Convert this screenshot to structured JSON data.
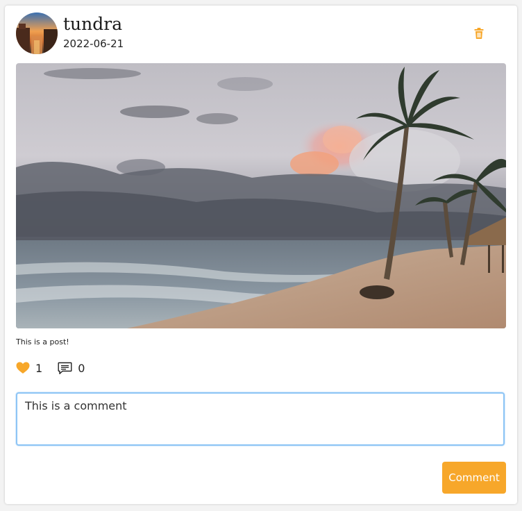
{
  "post": {
    "username": "tundra",
    "date": "2022-06-21",
    "caption": "This is a post!",
    "likes": "1",
    "comments": "0"
  },
  "comment_form": {
    "value": "This is a comment",
    "button_label": "Comment"
  },
  "icons": {
    "delete": "trash-icon",
    "like": "heart-icon",
    "comment": "comment-icon"
  },
  "colors": {
    "accent": "#f7a72a",
    "input_focus_border": "#8ec5f5"
  }
}
